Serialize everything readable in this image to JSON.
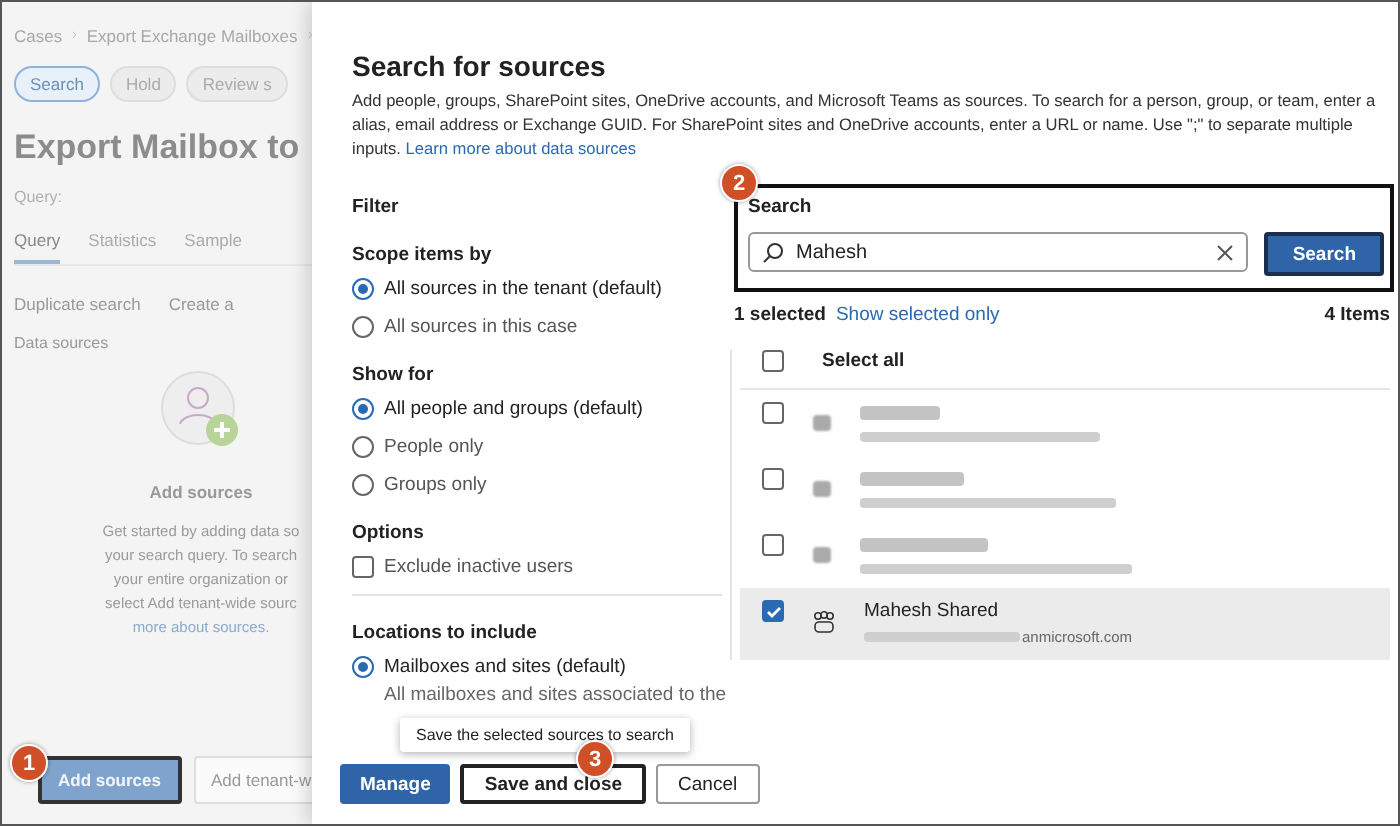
{
  "background_page": {
    "breadcrumb": [
      "Cases",
      "Export Exchange Mailboxes"
    ],
    "chips": [
      {
        "label": "Search",
        "selected": true
      },
      {
        "label": "Hold",
        "selected": false
      },
      {
        "label": "Review s",
        "selected": false
      }
    ],
    "title": "Export Mailbox to",
    "query_label": "Query:",
    "tabs": [
      {
        "label": "Query",
        "selected": true
      },
      {
        "label": "Statistics",
        "selected": false
      },
      {
        "label": "Sample",
        "selected": false
      }
    ],
    "toolbar": [
      "Duplicate search",
      "Create a"
    ],
    "section": "Data sources",
    "empty_title": "Add sources",
    "empty_lines": [
      "Get started by adding data so",
      "your search query. To search",
      "your entire organization or",
      "select Add tenant-wide sourc"
    ],
    "empty_link": "more about sources.",
    "buttons": [
      {
        "label": "Add sources",
        "kind": "primary"
      },
      {
        "label": "Add tenant-w",
        "kind": "secondary"
      }
    ]
  },
  "panel": {
    "title": "Search for sources",
    "description": [
      "Add people, groups, SharePoint sites, OneDrive accounts, and Microsoft Teams as sources. To search for a person, group, or team, enter a",
      "alias, email address or Exchange GUID. For SharePoint sites and OneDrive accounts, enter a URL or name. Use \";\" to separate multiple",
      "inputs."
    ],
    "learn_link": "Learn more about data sources",
    "filter": {
      "title": "Filter",
      "groups": [
        {
          "title": "Scope items by",
          "kind": "radio",
          "options": [
            {
              "label": "All sources in the tenant (default)",
              "selected": true
            },
            {
              "label": "All sources in this case",
              "selected": false
            }
          ]
        },
        {
          "title": "Show for",
          "kind": "radio",
          "options": [
            {
              "label": "All people and groups (default)",
              "selected": true
            },
            {
              "label": "People only",
              "selected": false
            },
            {
              "label": "Groups only",
              "selected": false
            }
          ]
        },
        {
          "title": "Options",
          "kind": "checkbox",
          "options": [
            {
              "label": "Exclude inactive users",
              "selected": false
            }
          ]
        },
        {
          "title": "Locations to include",
          "kind": "radio",
          "options": [
            {
              "label": "Mailboxes and sites (default)",
              "selected": true,
              "note": "All mailboxes and sites associated to the"
            }
          ]
        }
      ]
    },
    "search": {
      "label": "Search",
      "value": "Mahesh",
      "button": "Search"
    },
    "selection_count": "1 selected",
    "show_selected_link": "Show selected only",
    "item_count": "4 Items",
    "select_all": {
      "label": "Select all",
      "checked": false
    },
    "results": [
      {
        "kind": "redacted",
        "checked": false
      },
      {
        "kind": "redacted",
        "checked": false
      },
      {
        "kind": "redacted",
        "checked": false
      },
      {
        "kind": "group",
        "name": "Mahesh Shared",
        "email": "anmicrosoft.com",
        "checked": true
      }
    ],
    "footer": [
      {
        "label": "Manage",
        "kind": "primary"
      },
      {
        "label": "Save and close",
        "kind": "highlighted"
      },
      {
        "label": "Cancel",
        "kind": "secondary"
      }
    ],
    "tooltip": "Save the selected sources to search"
  },
  "steps": [
    "1",
    "2",
    "3"
  ]
}
